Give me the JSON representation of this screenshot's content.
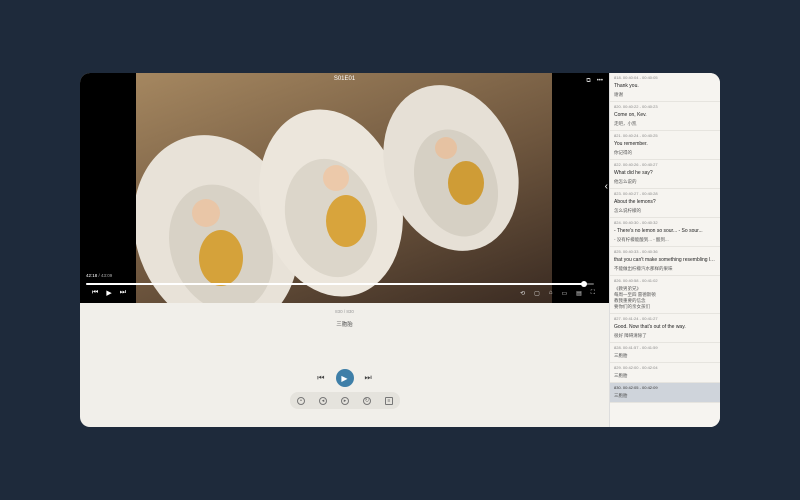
{
  "player": {
    "title": "S01E01",
    "current_time": "42:18",
    "total_time": "43:09",
    "progress": 0.98,
    "subtitle_index": "830 / 830",
    "current_subtitle": "三胞胎"
  },
  "transcript": [
    {
      "tc": "818.  00:40:04 - 00:40:05",
      "en": "Thank you.",
      "zh": [
        "谢谢"
      ]
    },
    {
      "tc": "820.  00:40:22 - 00:40:23",
      "en": "Come on, Kev.",
      "zh": [
        "走吧，小凯"
      ]
    },
    {
      "tc": "821.  00:40:24 - 00:40:25",
      "en": "You remember.",
      "zh": [
        "你记得的"
      ]
    },
    {
      "tc": "822.  00:40:26 - 00:40:27",
      "en": "What did he say?",
      "zh": [
        "他怎么说的"
      ]
    },
    {
      "tc": "823.  00:40:27 - 00:40:28",
      "en": "About the lemons?",
      "zh": [
        "怎么说柠檬的"
      ]
    },
    {
      "tc": "824.  00:40:30 - 00:40:32",
      "en": "- There's no lemon so sour... - So sour...",
      "zh": [
        "- 没有柠檬能酸到... - 酸到..."
      ]
    },
    {
      "tc": "825.  00:40:33 - 00:40:36",
      "en": "that you can't make something resembling lemonade.\"",
      "zh": [
        "不能做出柠檬汽水那样的果味"
      ]
    },
    {
      "tc": "826.  00:40:58 - 00:41:02",
      "en": "",
      "zh": [
        "《教男弟兄》",
        "每周一至四  雷德斯顿",
        "教我重要的信念",
        "要你们的亲女孩们"
      ]
    },
    {
      "tc": "827.  00:41:24 - 00:41:27",
      "en": "Good. Now that's out of the way.",
      "zh": [
        "很好 障碍清除了"
      ]
    },
    {
      "tc": "828.  00:41:57 - 00:41:59",
      "en": "",
      "zh": [
        "三胞胎"
      ]
    },
    {
      "tc": "829.  00:42:00 - 00:42:04",
      "en": "",
      "zh": [
        "三胞胎"
      ]
    },
    {
      "tc": "830.  00:42:05 - 00:42:09",
      "en": "",
      "zh": [
        "三胞胎"
      ],
      "selected": true
    }
  ]
}
